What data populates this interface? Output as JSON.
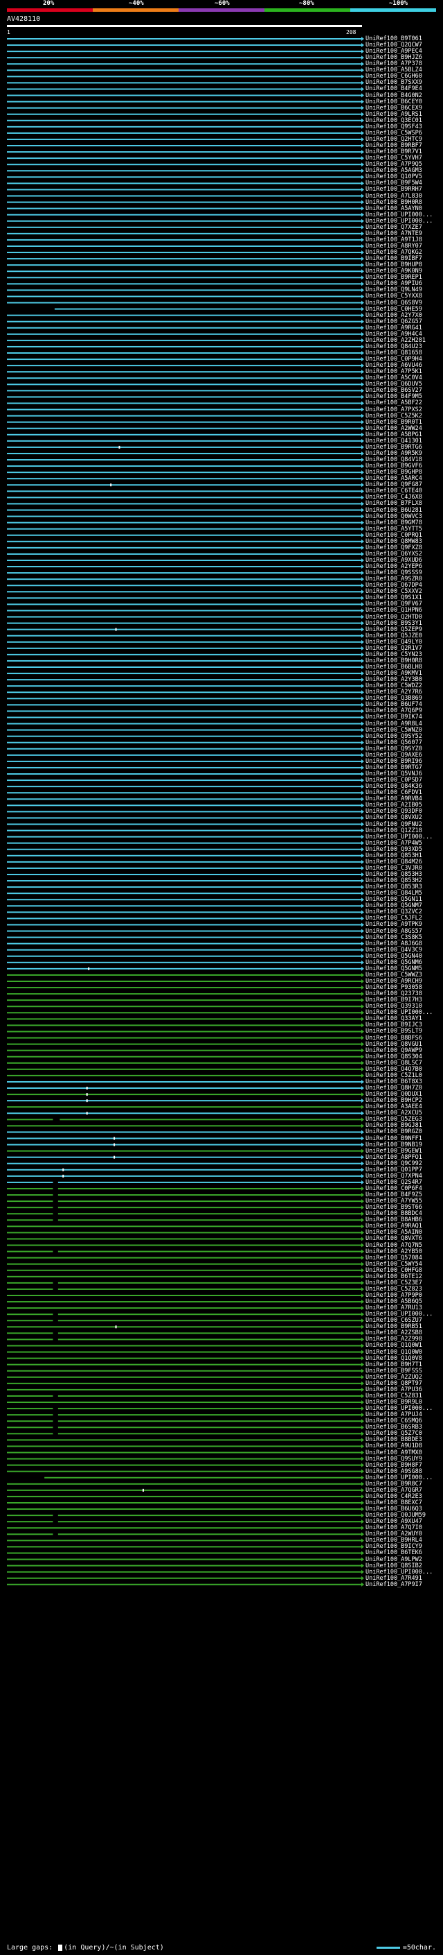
{
  "scale": {
    "labels": [
      "20%",
      "~40%",
      "~60%",
      "~80%",
      "~100%"
    ],
    "colors": [
      "#d9001c",
      "#ee7d18",
      "#8b3ab2",
      "#2cb31f",
      "#3ed0e3"
    ]
  },
  "query": {
    "id": "AV428110",
    "start": "1",
    "end": "208"
  },
  "colors": {
    "cyan": "#4ecbe6",
    "green": "#3aa82a",
    "gap": "#ffffff",
    "large_gap_block": "#000000"
  },
  "hits": [
    {
      "id": "UniRef100_B9T061",
      "color": "cyan"
    },
    {
      "id": "UniRef100_Q2QCW7",
      "color": "cyan"
    },
    {
      "id": "UniRef100_A9PEC4",
      "color": "cyan"
    },
    {
      "id": "UniRef100_B9HJZ6",
      "color": "cyan"
    },
    {
      "id": "UniRef100_A7P378",
      "color": "cyan"
    },
    {
      "id": "UniRef100_A5BLZ4",
      "color": "cyan"
    },
    {
      "id": "UniRef100_C6GH60",
      "color": "cyan"
    },
    {
      "id": "UniRef100_B7SXX9",
      "color": "cyan"
    },
    {
      "id": "UniRef100_B4F9E4",
      "color": "cyan"
    },
    {
      "id": "UniRef100_B4G0N2",
      "color": "cyan"
    },
    {
      "id": "UniRef100_B6CEY0",
      "color": "cyan"
    },
    {
      "id": "UniRef100_B6CEX9",
      "color": "cyan"
    },
    {
      "id": "UniRef100_A9LRS1",
      "color": "cyan"
    },
    {
      "id": "UniRef100_Q3EC01",
      "color": "cyan"
    },
    {
      "id": "UniRef100_Q9SF43",
      "color": "cyan"
    },
    {
      "id": "UniRef100_C5WSP6",
      "color": "cyan"
    },
    {
      "id": "UniRef100_Q2HTC9",
      "color": "cyan"
    },
    {
      "id": "UniRef100_B9RBF7",
      "color": "cyan"
    },
    {
      "id": "UniRef100_B9R7V1",
      "color": "cyan"
    },
    {
      "id": "UniRef100_C5YVH7",
      "color": "cyan"
    },
    {
      "id": "UniRef100_A7P9Q5",
      "color": "cyan"
    },
    {
      "id": "UniRef100_A5AGM3",
      "color": "cyan"
    },
    {
      "id": "UniRef100_Q10PV5",
      "color": "cyan"
    },
    {
      "id": "UniRef100_B9F5W4",
      "color": "cyan"
    },
    {
      "id": "UniRef100_B9RRH7",
      "color": "cyan"
    },
    {
      "id": "UniRef100_A7L830",
      "color": "cyan"
    },
    {
      "id": "UniRef100_B9H0R8",
      "color": "cyan"
    },
    {
      "id": "UniRef100_A5AYN0",
      "color": "cyan"
    },
    {
      "id": "UniRef100_UPI000...",
      "color": "cyan"
    },
    {
      "id": "UniRef100_UPI000...",
      "color": "cyan"
    },
    {
      "id": "UniRef100_Q7XZE7",
      "color": "cyan"
    },
    {
      "id": "UniRef100_A7NTE9",
      "color": "cyan"
    },
    {
      "id": "UniRef100_A9T1J8",
      "color": "cyan"
    },
    {
      "id": "UniRef100_A8RY07",
      "color": "cyan"
    },
    {
      "id": "UniRef100_A7QKG2",
      "color": "cyan"
    },
    {
      "id": "UniRef100_B9IBF7",
      "color": "cyan"
    },
    {
      "id": "UniRef100_B9HUP8",
      "color": "cyan"
    },
    {
      "id": "UniRef100_A9K0N9",
      "color": "cyan"
    },
    {
      "id": "UniRef100_B9REP1",
      "color": "cyan"
    },
    {
      "id": "UniRef100_A9PIU6",
      "color": "cyan"
    },
    {
      "id": "UniRef100_Q9LN49",
      "color": "cyan"
    },
    {
      "id": "UniRef100_C5YXX8",
      "color": "cyan"
    },
    {
      "id": "UniRef100_Q6S8V9",
      "color": "cyan"
    },
    {
      "id": "UniRef100_C0HE59",
      "color": "cyan",
      "gap_start": 0,
      "gap_end": 28
    },
    {
      "id": "UniRef100_A2Y7X0",
      "color": "cyan"
    },
    {
      "id": "UniRef100_Q6ZG57",
      "color": "cyan"
    },
    {
      "id": "UniRef100_A9RG41",
      "color": "cyan"
    },
    {
      "id": "UniRef100_A9H4C4",
      "color": "cyan"
    },
    {
      "id": "UniRef100_A2ZH281",
      "color": "cyan"
    },
    {
      "id": "UniRef100_Q84U23",
      "color": "cyan"
    },
    {
      "id": "UniRef100_Q81658",
      "color": "cyan"
    },
    {
      "id": "UniRef100_C0P9H4",
      "color": "cyan"
    },
    {
      "id": "UniRef100_A6VU46",
      "color": "cyan"
    },
    {
      "id": "UniRef100_A7P5K1",
      "color": "cyan"
    },
    {
      "id": "UniRef100_A5C0V4",
      "color": "cyan"
    },
    {
      "id": "UniRef100_Q6DUV5",
      "color": "cyan"
    },
    {
      "id": "UniRef100_B6SV27",
      "color": "cyan"
    },
    {
      "id": "UniRef100_B4F9M5",
      "color": "cyan"
    },
    {
      "id": "UniRef100_A5BF22",
      "color": "cyan"
    },
    {
      "id": "UniRef100_A7PXS2",
      "color": "cyan"
    },
    {
      "id": "UniRef100_C5Z5K2",
      "color": "cyan"
    },
    {
      "id": "UniRef100_B9R0T1",
      "color": "cyan"
    },
    {
      "id": "UniRef100_A2WW24",
      "color": "cyan"
    },
    {
      "id": "UniRef100_A5BPG1",
      "color": "cyan"
    },
    {
      "id": "UniRef100_Q41301",
      "color": "cyan"
    },
    {
      "id": "UniRef100_B9RTG6",
      "color": "cyan",
      "gap_at": 66
    },
    {
      "id": "UniRef100_A9R5K9",
      "color": "cyan"
    },
    {
      "id": "UniRef100_Q84V18",
      "color": "cyan"
    },
    {
      "id": "UniRef100_B9GVF6",
      "color": "cyan"
    },
    {
      "id": "UniRef100_B9GHP8",
      "color": "cyan"
    },
    {
      "id": "UniRef100_A5ARC4",
      "color": "cyan"
    },
    {
      "id": "UniRef100_Q9FG87",
      "color": "cyan",
      "gap_at": 61
    },
    {
      "id": "UniRef100_C6TE40",
      "color": "cyan"
    },
    {
      "id": "UniRef100_C4J6X8",
      "color": "cyan"
    },
    {
      "id": "UniRef100_B7FLX8",
      "color": "cyan"
    },
    {
      "id": "UniRef100_B6U281",
      "color": "cyan"
    },
    {
      "id": "UniRef100_Q0WVC3",
      "color": "cyan"
    },
    {
      "id": "UniRef100_B9GM78",
      "color": "cyan"
    },
    {
      "id": "UniRef100_A5YTT5",
      "color": "cyan"
    },
    {
      "id": "UniRef100_C0PRQ1",
      "color": "cyan"
    },
    {
      "id": "UniRef100_Q8MW83",
      "color": "cyan"
    },
    {
      "id": "UniRef100_Q9FXZ8",
      "color": "cyan"
    },
    {
      "id": "UniRef100_Q6YXS2",
      "color": "cyan"
    },
    {
      "id": "UniRef100_A9XUD6",
      "color": "cyan"
    },
    {
      "id": "UniRef100_A2YEP6",
      "color": "cyan"
    },
    {
      "id": "UniRef100_Q9SSS9",
      "color": "cyan"
    },
    {
      "id": "UniRef100_A9SZR0",
      "color": "cyan"
    },
    {
      "id": "UniRef100_Q67DP4",
      "color": "cyan"
    },
    {
      "id": "UniRef100_C5XXV2",
      "color": "cyan"
    },
    {
      "id": "UniRef100_Q9S1X1",
      "color": "cyan"
    },
    {
      "id": "UniRef100_Q9FV67",
      "color": "cyan"
    },
    {
      "id": "UniRef100_Q1HPN6",
      "color": "cyan"
    },
    {
      "id": "UniRef100_Q2HTD0",
      "color": "cyan"
    },
    {
      "id": "UniRef100_B9S3Y1",
      "color": "cyan"
    },
    {
      "id": "UniRef100_Q5ZEP9",
      "color": "cyan",
      "gap_at": 64
    },
    {
      "id": "UniRef100_Q5JZE0",
      "color": "cyan"
    },
    {
      "id": "UniRef100_Q49LY0",
      "color": "cyan"
    },
    {
      "id": "UniRef100_Q2R1V7",
      "color": "cyan"
    },
    {
      "id": "UniRef100_C5YN23",
      "color": "cyan"
    },
    {
      "id": "UniRef100_B9H0R8",
      "color": "cyan"
    },
    {
      "id": "UniRef100_B6BLH8",
      "color": "cyan"
    },
    {
      "id": "UniRef100_A9KMV1",
      "color": "cyan"
    },
    {
      "id": "UniRef100_A2Y3B0",
      "color": "cyan"
    },
    {
      "id": "UniRef100_C5WDZ2",
      "color": "cyan"
    },
    {
      "id": "UniRef100_A2Y7R6",
      "color": "cyan"
    },
    {
      "id": "UniRef100_Q3B869",
      "color": "cyan"
    },
    {
      "id": "UniRef100_B6UF74",
      "color": "cyan"
    },
    {
      "id": "UniRef100_A7Q6P9",
      "color": "cyan"
    },
    {
      "id": "UniRef100_B9IK74",
      "color": "cyan"
    },
    {
      "id": "UniRef100_A9R8L4",
      "color": "cyan"
    },
    {
      "id": "UniRef100_C5WNZ0",
      "color": "cyan"
    },
    {
      "id": "UniRef100_Q9SY52",
      "color": "cyan"
    },
    {
      "id": "UniRef100_Q56077",
      "color": "cyan"
    },
    {
      "id": "UniRef100_Q9SYZ0",
      "color": "cyan"
    },
    {
      "id": "UniRef100_Q9AXE6",
      "color": "cyan"
    },
    {
      "id": "UniRef100_B9RI96",
      "color": "cyan"
    },
    {
      "id": "UniRef100_B9RTG7",
      "color": "cyan"
    },
    {
      "id": "UniRef100_Q5VNJ6",
      "color": "cyan"
    },
    {
      "id": "UniRef100_C0PSD7",
      "color": "cyan"
    },
    {
      "id": "UniRef100_Q84K36",
      "color": "cyan"
    },
    {
      "id": "UniRef100_C6FDV1",
      "color": "cyan"
    },
    {
      "id": "UniRef100_A9RVB4",
      "color": "cyan"
    },
    {
      "id": "UniRef100_A2IB05",
      "color": "cyan"
    },
    {
      "id": "UniRef100_Q93DF0",
      "color": "cyan"
    },
    {
      "id": "UniRef100_Q8VXU2",
      "color": "cyan"
    },
    {
      "id": "UniRef100_Q9FNU2",
      "color": "cyan"
    },
    {
      "id": "UniRef100_Q1ZZ18",
      "color": "cyan"
    },
    {
      "id": "UniRef100_UPI000...",
      "color": "cyan"
    },
    {
      "id": "UniRef100_A7P4W5",
      "color": "cyan"
    },
    {
      "id": "UniRef100_Q93XD5",
      "color": "cyan"
    },
    {
      "id": "UniRef100_Q853H1",
      "color": "cyan"
    },
    {
      "id": "UniRef100_Q84M26",
      "color": "cyan"
    },
    {
      "id": "UniRef100_C3VJR0",
      "color": "cyan"
    },
    {
      "id": "UniRef100_Q853H3",
      "color": "cyan"
    },
    {
      "id": "UniRef100_Q853H2",
      "color": "cyan"
    },
    {
      "id": "UniRef100_Q853R3",
      "color": "cyan"
    },
    {
      "id": "UniRef100_Q84LM5",
      "color": "cyan"
    },
    {
      "id": "UniRef100_Q5GN11",
      "color": "cyan"
    },
    {
      "id": "UniRef100_Q5GNM7",
      "color": "cyan"
    },
    {
      "id": "UniRef100_Q3ZVC2",
      "color": "cyan"
    },
    {
      "id": "UniRef100_C5JFL2",
      "color": "cyan"
    },
    {
      "id": "UniRef100_A9TPK9",
      "color": "cyan"
    },
    {
      "id": "UniRef100_A8GS57",
      "color": "cyan"
    },
    {
      "id": "UniRef100_C3S8K5",
      "color": "cyan"
    },
    {
      "id": "UniRef100_A8J6G8",
      "color": "cyan"
    },
    {
      "id": "UniRef100_Q4V3C9",
      "color": "cyan"
    },
    {
      "id": "UniRef100_Q5GN40",
      "color": "cyan"
    },
    {
      "id": "UniRef100_Q5GNM6",
      "color": "cyan"
    },
    {
      "id": "UniRef100_Q5GNM5",
      "color": "cyan",
      "gap_at": 48
    },
    {
      "id": "UniRef100_C5WWZ3",
      "color": "green"
    },
    {
      "id": "UniRef100_A9RCH9",
      "color": "green"
    },
    {
      "id": "UniRef100_P93058",
      "color": "green"
    },
    {
      "id": "UniRef100_Q23738",
      "color": "green"
    },
    {
      "id": "UniRef100_B9I7H3",
      "color": "green"
    },
    {
      "id": "UniRef100_Q39310",
      "color": "green"
    },
    {
      "id": "UniRef100_UPI000...",
      "color": "green"
    },
    {
      "id": "UniRef100_Q33AY1",
      "color": "green"
    },
    {
      "id": "UniRef100_B9IJC3",
      "color": "green"
    },
    {
      "id": "UniRef100_B9SLT9",
      "color": "green"
    },
    {
      "id": "UniRef100_B8BFS6",
      "color": "green"
    },
    {
      "id": "UniRef100_Q8VGU1",
      "color": "green"
    },
    {
      "id": "UniRef100_Q9AWP9",
      "color": "green"
    },
    {
      "id": "UniRef100_Q8S304",
      "color": "green"
    },
    {
      "id": "UniRef100_Q8LSC7",
      "color": "green"
    },
    {
      "id": "UniRef100_O4O7B0",
      "color": "green"
    },
    {
      "id": "UniRef100_C5Z1L0",
      "color": "green"
    },
    {
      "id": "UniRef100_B6T8X3",
      "color": "cyan"
    },
    {
      "id": "UniRef100_Q8H7Z0",
      "color": "cyan",
      "gap_at": 47
    },
    {
      "id": "UniRef100_Q0DUX1",
      "color": "green",
      "gap_at": 47
    },
    {
      "id": "UniRef100_B9HCP2",
      "color": "cyan",
      "gap_at": 47
    },
    {
      "id": "UniRef100_A3AEE4",
      "color": "green"
    },
    {
      "id": "UniRef100_A2XCU5",
      "color": "cyan",
      "gap_at": 47
    },
    {
      "id": "UniRef100_Q5ZEG3",
      "color": "green",
      "gap_start": 27,
      "gap_end": 31
    },
    {
      "id": "UniRef100_B9GJ81",
      "color": "green"
    },
    {
      "id": "UniRef100_B9RGZ0",
      "color": "cyan"
    },
    {
      "id": "UniRef100_B9NFF1",
      "color": "cyan",
      "gap_at": 63
    },
    {
      "id": "UniRef100_B9NB19",
      "color": "cyan",
      "gap_at": 63
    },
    {
      "id": "UniRef100_B9GEW1",
      "color": "green"
    },
    {
      "id": "UniRef100_A8PFO1",
      "color": "cyan",
      "gap_at": 63
    },
    {
      "id": "UniRef100_Q9C992",
      "color": "cyan"
    },
    {
      "id": "UniRef100_Q01PP7",
      "color": "cyan",
      "gap_at": 33
    },
    {
      "id": "UniRef100_Q7XPN4",
      "color": "cyan",
      "gap_at": 33
    },
    {
      "id": "UniRef100_Q2S4R7",
      "color": "cyan",
      "gap_start": 27,
      "gap_end": 30
    },
    {
      "id": "UniRef100_C0P6F4",
      "color": "green",
      "gap_start": 27,
      "gap_end": 30
    },
    {
      "id": "UniRef100_B4F9Z5",
      "color": "green",
      "gap_start": 27,
      "gap_end": 30
    },
    {
      "id": "UniRef100_A7YW55",
      "color": "green",
      "gap_start": 27,
      "gap_end": 30
    },
    {
      "id": "UniRef100_B9ST66",
      "color": "green",
      "gap_start": 27,
      "gap_end": 30
    },
    {
      "id": "UniRef100_B8BDC4",
      "color": "green",
      "gap_start": 27,
      "gap_end": 30
    },
    {
      "id": "UniRef100_B8AHB6",
      "color": "green",
      "gap_start": 27,
      "gap_end": 30
    },
    {
      "id": "UniRef100_A9RAQ1",
      "color": "green"
    },
    {
      "id": "UniRef100_A5AIN0",
      "color": "green"
    },
    {
      "id": "UniRef100_Q8VXT6",
      "color": "green"
    },
    {
      "id": "UniRef100_A7Q7N5",
      "color": "green"
    },
    {
      "id": "UniRef100_A2YB50",
      "color": "green",
      "gap_start": 27,
      "gap_end": 30
    },
    {
      "id": "UniRef100_Q57084",
      "color": "green"
    },
    {
      "id": "UniRef100_C5WY54",
      "color": "green"
    },
    {
      "id": "UniRef100_C0HFG8",
      "color": "green"
    },
    {
      "id": "UniRef100_B6TE12",
      "color": "green"
    },
    {
      "id": "UniRef100_C5Z3E7",
      "color": "green",
      "gap_start": 27,
      "gap_end": 30
    },
    {
      "id": "UniRef100_C5Z823",
      "color": "green",
      "gap_start": 27,
      "gap_end": 30
    },
    {
      "id": "UniRef100_A7P9P0",
      "color": "green"
    },
    {
      "id": "UniRef100_A5B6Q5",
      "color": "green"
    },
    {
      "id": "UniRef100_A7RU13",
      "color": "green"
    },
    {
      "id": "UniRef100_UPI000...",
      "color": "green",
      "gap_start": 27,
      "gap_end": 30
    },
    {
      "id": "UniRef100_C6SZU7",
      "color": "green",
      "gap_start": 27,
      "gap_end": 30
    },
    {
      "id": "UniRef100_B9RB51",
      "color": "green",
      "gap_at": 64
    },
    {
      "id": "UniRef100_A2ZSB8",
      "color": "green",
      "gap_start": 27,
      "gap_end": 30
    },
    {
      "id": "UniRef100_A2Z998",
      "color": "green",
      "gap_start": 27,
      "gap_end": 30
    },
    {
      "id": "UniRef100_Q1Q0W1",
      "color": "green"
    },
    {
      "id": "UniRef100_Q1Q0W0",
      "color": "green"
    },
    {
      "id": "UniRef100_Q1Q0V8",
      "color": "green"
    },
    {
      "id": "UniRef100_B9H7T1",
      "color": "green"
    },
    {
      "id": "UniRef100_B9FSSS",
      "color": "green"
    },
    {
      "id": "UniRef100_A2ZUQ2",
      "color": "green"
    },
    {
      "id": "UniRef100_Q8PT97",
      "color": "green"
    },
    {
      "id": "UniRef100_A7PU36",
      "color": "green"
    },
    {
      "id": "UniRef100_C5Z831",
      "color": "green",
      "gap_start": 27,
      "gap_end": 30
    },
    {
      "id": "UniRef100_B9R9L0",
      "color": "green"
    },
    {
      "id": "UniRef100_UPI000...",
      "color": "green",
      "gap_start": 27,
      "gap_end": 30
    },
    {
      "id": "UniRef100_A7PUJ4",
      "color": "green",
      "gap_start": 27,
      "gap_end": 30
    },
    {
      "id": "UniRef100_C6SMQ6",
      "color": "green",
      "gap_start": 27,
      "gap_end": 30
    },
    {
      "id": "UniRef100_B6SRB3",
      "color": "green",
      "gap_start": 27,
      "gap_end": 30
    },
    {
      "id": "UniRef100_Q5Z7C0",
      "color": "green",
      "gap_start": 27,
      "gap_end": 30
    },
    {
      "id": "UniRef100_B8BDE3",
      "color": "green"
    },
    {
      "id": "UniRef100_A9U1D8",
      "color": "green"
    },
    {
      "id": "UniRef100_A9TMX0",
      "color": "green"
    },
    {
      "id": "UniRef100_Q9SUY9",
      "color": "green"
    },
    {
      "id": "UniRef100_B9H8F7",
      "color": "green"
    },
    {
      "id": "UniRef100_A9SG88",
      "color": "green"
    },
    {
      "id": "UniRef100_UPI000...",
      "color": "green",
      "gap_start": 0,
      "gap_end": 22
    },
    {
      "id": "UniRef100_B9R8C7",
      "color": "green"
    },
    {
      "id": "UniRef100_A7QGR7",
      "color": "green",
      "gap_at": 80
    },
    {
      "id": "UniRef100_C4R2E3",
      "color": "green"
    },
    {
      "id": "UniRef100_B8EXC7",
      "color": "green"
    },
    {
      "id": "UniRef100_B6U6Q3",
      "color": "green"
    },
    {
      "id": "UniRef100_Q0JUM59",
      "color": "green",
      "gap_start": 27,
      "gap_end": 30
    },
    {
      "id": "UniRef100_A9XU47",
      "color": "green",
      "gap_start": 27,
      "gap_end": 30
    },
    {
      "id": "UniRef100_A7Q7I0",
      "color": "green"
    },
    {
      "id": "UniRef100_A2WUY0",
      "color": "green",
      "gap_start": 27,
      "gap_end": 30
    },
    {
      "id": "UniRef100_B9HRL4",
      "color": "green"
    },
    {
      "id": "UniRef100_B9ICY9",
      "color": "green"
    },
    {
      "id": "UniRef100_B6TEK6",
      "color": "green"
    },
    {
      "id": "UniRef100_A9LPW2",
      "color": "green"
    },
    {
      "id": "UniRef100_Q8SIB2",
      "color": "green"
    },
    {
      "id": "UniRef100_UPI000...",
      "color": "green"
    },
    {
      "id": "UniRef100_A7R491",
      "color": "green"
    },
    {
      "id": "UniRef100_A7P9I7",
      "color": "green"
    }
  ],
  "legend": {
    "large_gaps_label": "Large gaps:",
    "in_query": "(in Query)",
    "in_subject": "/~(in Subject)",
    "scale_text": "=50char."
  }
}
